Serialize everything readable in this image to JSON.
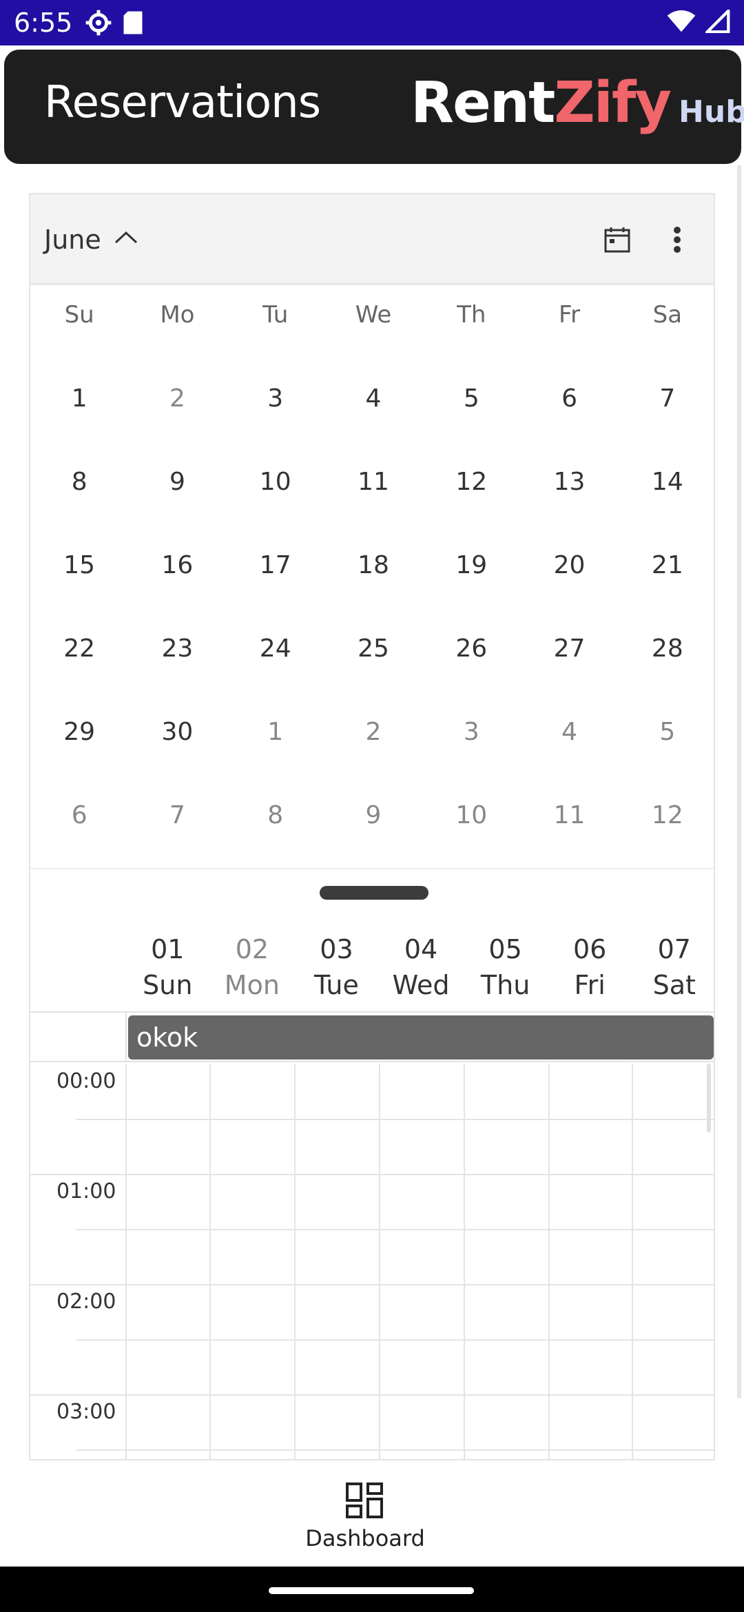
{
  "status_bar": {
    "time": "6:55"
  },
  "header": {
    "title": "Reservations",
    "logo": {
      "part1": "Rent",
      "part2": "Zify",
      "part3": "Hub"
    }
  },
  "calendar": {
    "month": "June",
    "weekdays": [
      "Su",
      "Mo",
      "Tu",
      "We",
      "Th",
      "Fr",
      "Sa"
    ],
    "dates": [
      [
        "1",
        "2",
        "3",
        "4",
        "5",
        "6",
        "7"
      ],
      [
        "8",
        "9",
        "10",
        "11",
        "12",
        "13",
        "14"
      ],
      [
        "15",
        "16",
        "17",
        "18",
        "19",
        "20",
        "21"
      ],
      [
        "22",
        "23",
        "24",
        "25",
        "26",
        "27",
        "28"
      ],
      [
        "29",
        "30",
        "1",
        "2",
        "3",
        "4",
        "5"
      ],
      [
        "6",
        "7",
        "8",
        "9",
        "10",
        "11",
        "12"
      ]
    ],
    "week_days": [
      {
        "num": "01",
        "name": "Sun"
      },
      {
        "num": "02",
        "name": "Mon"
      },
      {
        "num": "03",
        "name": "Tue"
      },
      {
        "num": "04",
        "name": "Wed"
      },
      {
        "num": "05",
        "name": "Thu"
      },
      {
        "num": "06",
        "name": "Fri"
      },
      {
        "num": "07",
        "name": "Sat"
      }
    ],
    "event": "okok",
    "times": [
      "00:00",
      "01:00",
      "02:00",
      "03:00"
    ]
  },
  "bottom_nav": {
    "dashboard_label": "Dashboard"
  }
}
